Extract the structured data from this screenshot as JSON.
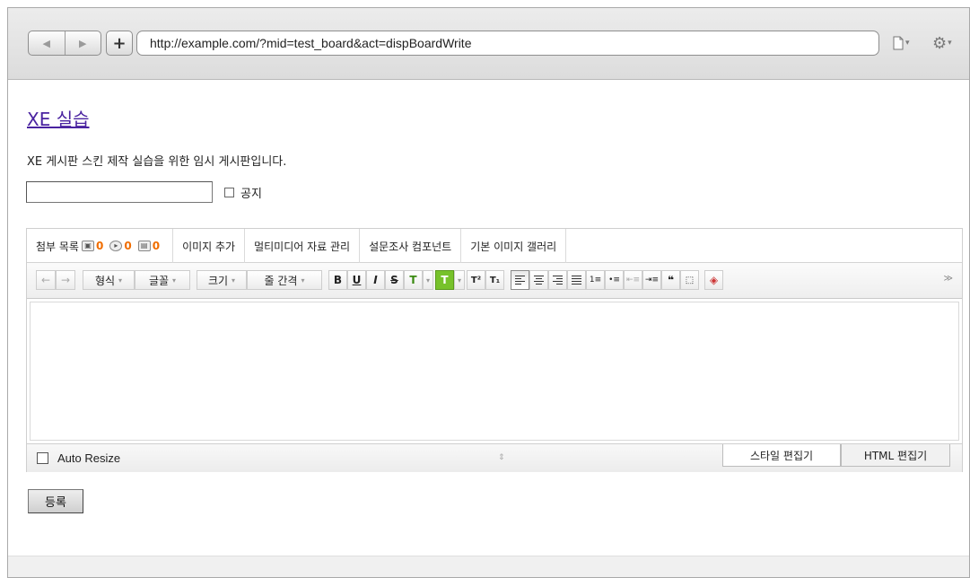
{
  "browser": {
    "url": "http://example.com/?mid=test_board&act=dispBoardWrite",
    "back_glyph": "◀",
    "forward_glyph": "▶",
    "add_glyph": "+",
    "page_menu_glyph": "🗋",
    "settings_glyph": "⚙",
    "caret_glyph": "▾"
  },
  "page": {
    "title": "XE 실습",
    "description": "XE 게시판 스킨 제작 실습을 위한 임시 게시판입니다.",
    "title_input_value": "",
    "notice_label": "공지",
    "submit_label": "등록"
  },
  "editor": {
    "tabs": {
      "attach_label": "첨부 목록",
      "image_count": "0",
      "media_count": "0",
      "file_count": "0",
      "add_image": "이미지 추가",
      "multimedia": "멀티미디어 자료 관리",
      "survey": "설문조사 컴포넌트",
      "gallery": "기본 이미지 갤러리"
    },
    "toolbar": {
      "undo": "←",
      "redo": "→",
      "format": "형식",
      "font": "글꼴",
      "size": "크기",
      "line_height": "줄 간격",
      "bold": "B",
      "underline": "U",
      "italic": "I",
      "strike": "S",
      "font_color": "T",
      "bg_color": "T",
      "superscript": "T²",
      "subscript": "T₁",
      "quote": "❝",
      "dropdown_glyph": "▾",
      "expand_glyph": "≫",
      "eraser_glyph": "◈"
    },
    "content_text": "",
    "auto_resize_label": "Auto Resize",
    "resize_glyph": "⇕",
    "mode_tabs": {
      "style": "스타일 편집기",
      "html": "HTML 편집기"
    },
    "colors": {
      "accent_green": "#77c22b",
      "count_orange": "#f06d00",
      "title_link": "#4a23a0"
    }
  }
}
